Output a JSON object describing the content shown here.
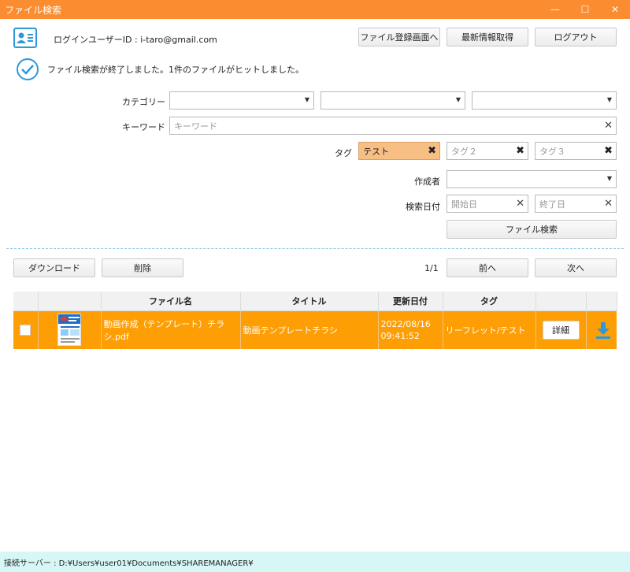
{
  "window": {
    "title": "ファイル検索",
    "controls": {
      "minimize": "—",
      "maximize": "☐",
      "close": "✕"
    }
  },
  "header": {
    "user_label": "ログインユーザーID : i-taro@gmail.com",
    "buttons": {
      "register": "ファイル登録画面へ",
      "refresh": "最新情報取得",
      "logout": "ログアウト"
    }
  },
  "message": "ファイル検索が終了しました。1件のファイルがヒットしました。",
  "search": {
    "category_label": "カテゴリー",
    "keyword_label": "キーワード",
    "keyword_placeholder": "キーワード",
    "tag_label": "タグ",
    "tag1_value": "テスト",
    "tag2_placeholder": "タグ２",
    "tag3_placeholder": "タグ３",
    "author_label": "作成者",
    "date_label": "検索日付",
    "start_placeholder": "開始日",
    "end_placeholder": "終了日",
    "search_button": "ファイル検索"
  },
  "actions": {
    "download": "ダウンロード",
    "delete": "削除",
    "page": "1/1",
    "prev": "前へ",
    "next": "次へ"
  },
  "table": {
    "headers": [
      "",
      "",
      "ファイル名",
      "タイトル",
      "更新日付",
      "タグ",
      "",
      ""
    ],
    "rows": [
      {
        "filename": "動画作成（テンプレート）チラシ.pdf",
        "title": "動画テンプレートチラシ",
        "date": "2022/08/16",
        "time": "09:41:52",
        "tag": "リーフレット/テスト",
        "detail": "詳細"
      }
    ]
  },
  "status_bar": "接続サーバー : D:¥Users¥user01¥Documents¥SHAREMANAGER¥",
  "colors": {
    "titlebar": "#fb8c2f",
    "row_selected": "#fe9e05",
    "accent_blue": "#2d9ad7",
    "tag_active": "#f8bf84",
    "status_bg": "#d7f7f7"
  }
}
